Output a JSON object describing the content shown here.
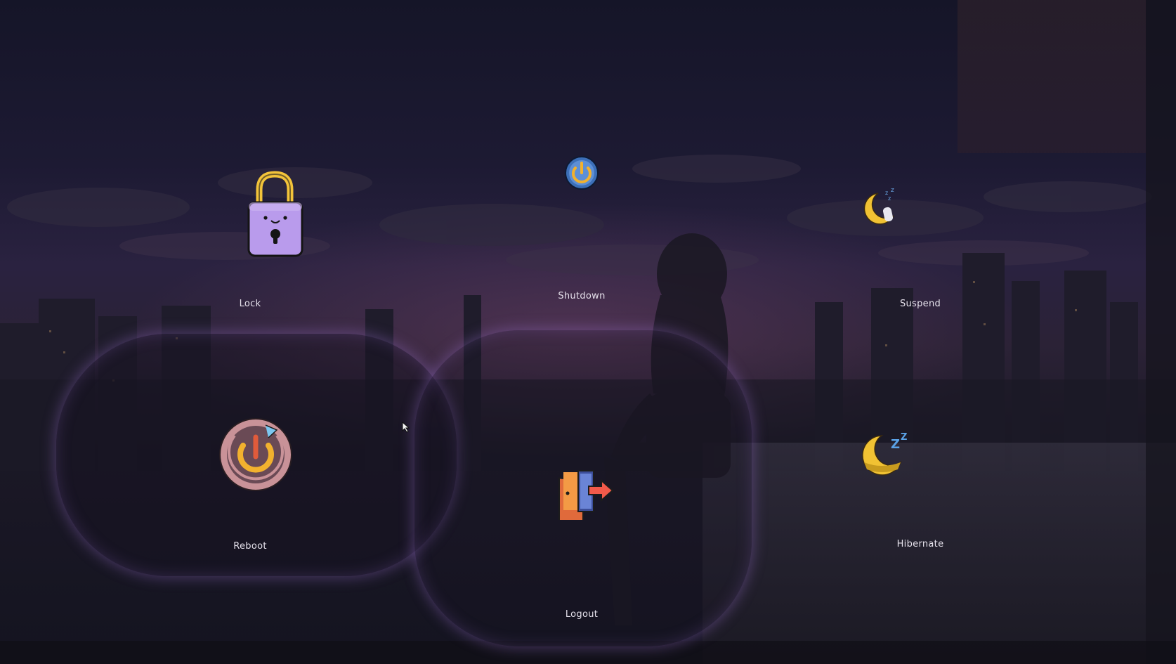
{
  "power_menu": {
    "actions": [
      {
        "id": "lock",
        "label": "Lock",
        "icon": "padlock-icon"
      },
      {
        "id": "shutdown",
        "label": "Shutdown",
        "icon": "power-icon"
      },
      {
        "id": "suspend",
        "label": "Suspend",
        "icon": "sleeping-moon-icon"
      },
      {
        "id": "reboot",
        "label": "Reboot",
        "icon": "reboot-power-icon"
      },
      {
        "id": "logout",
        "label": "Logout",
        "icon": "exit-door-icon"
      },
      {
        "id": "hibernate",
        "label": "Hibernate",
        "icon": "bell-moon-zzz-icon"
      }
    ],
    "selected": "reboot",
    "accent_color": "#9a78c8"
  }
}
